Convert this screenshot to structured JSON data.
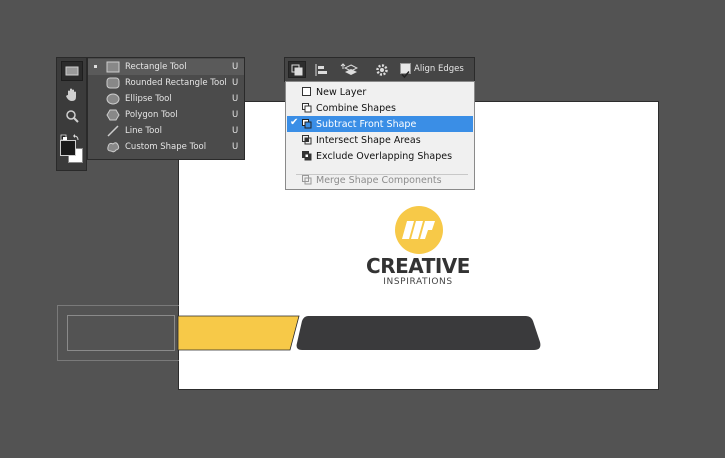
{
  "tool_flyout": {
    "items": [
      {
        "label": "Rectangle Tool",
        "key": "U",
        "icon": "rectangle-icon",
        "selected": true
      },
      {
        "label": "Rounded Rectangle Tool",
        "key": "U",
        "icon": "rounded-rectangle-icon"
      },
      {
        "label": "Ellipse Tool",
        "key": "U",
        "icon": "ellipse-icon"
      },
      {
        "label": "Polygon Tool",
        "key": "U",
        "icon": "polygon-icon"
      },
      {
        "label": "Line Tool",
        "key": "U",
        "icon": "line-icon"
      },
      {
        "label": "Custom Shape Tool",
        "key": "U",
        "icon": "custom-shape-icon"
      }
    ]
  },
  "options_bar": {
    "align_edges_label": "Align Edges",
    "align_edges_checked": true
  },
  "path_operations_menu": {
    "items": [
      {
        "label": "New Layer",
        "icon": "new-layer-icon"
      },
      {
        "label": "Combine Shapes",
        "icon": "combine-shapes-icon"
      },
      {
        "label": "Subtract Front Shape",
        "icon": "subtract-front-shape-icon",
        "checked": true,
        "highlighted": true
      },
      {
        "label": "Intersect Shape Areas",
        "icon": "intersect-shape-areas-icon"
      },
      {
        "label": "Exclude Overlapping Shapes",
        "icon": "exclude-overlapping-shapes-icon"
      }
    ],
    "merge_label": "Merge Shape Components",
    "merge_disabled": true
  },
  "document": {
    "logo_title": "CREATIVE",
    "logo_subtitle": "INSPIRATIONS",
    "accent_color": "#f7c948",
    "dark_color": "#3a3a3c"
  },
  "colors": {
    "background": "#535353",
    "menu_highlight": "#3a8ee6"
  }
}
